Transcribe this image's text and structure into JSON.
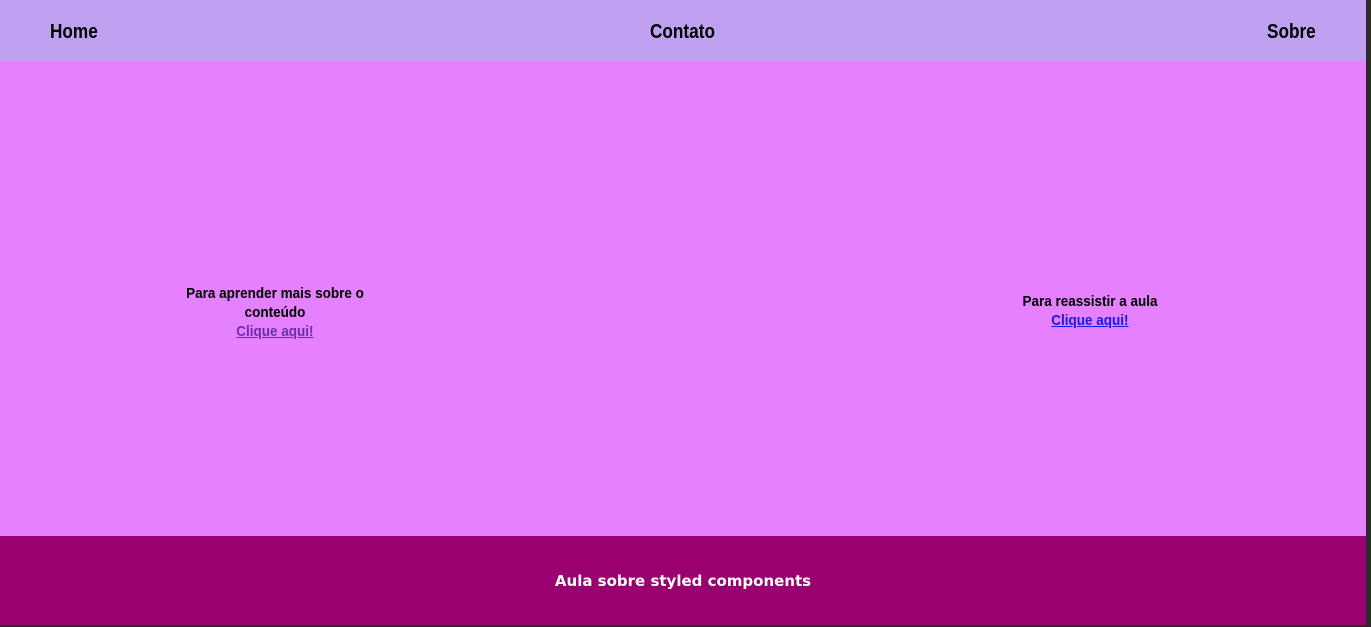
{
  "nav": {
    "home": "Home",
    "contato": "Contato",
    "sobre": "Sobre"
  },
  "main": {
    "left_card": {
      "text": "Para aprender mais sobre o conteúdo",
      "link": "Clique aqui!"
    },
    "right_card": {
      "text": "Para reassistir a aula",
      "link": "Clique aqui!"
    }
  },
  "footer": {
    "text": "Aula sobre styled components"
  },
  "colors": {
    "header_bg": "#c0a0f0",
    "main_bg": "#e580ff",
    "footer_bg": "#990070",
    "link_visited": "#6f2ca8",
    "link_unvisited": "#1a18e6"
  }
}
